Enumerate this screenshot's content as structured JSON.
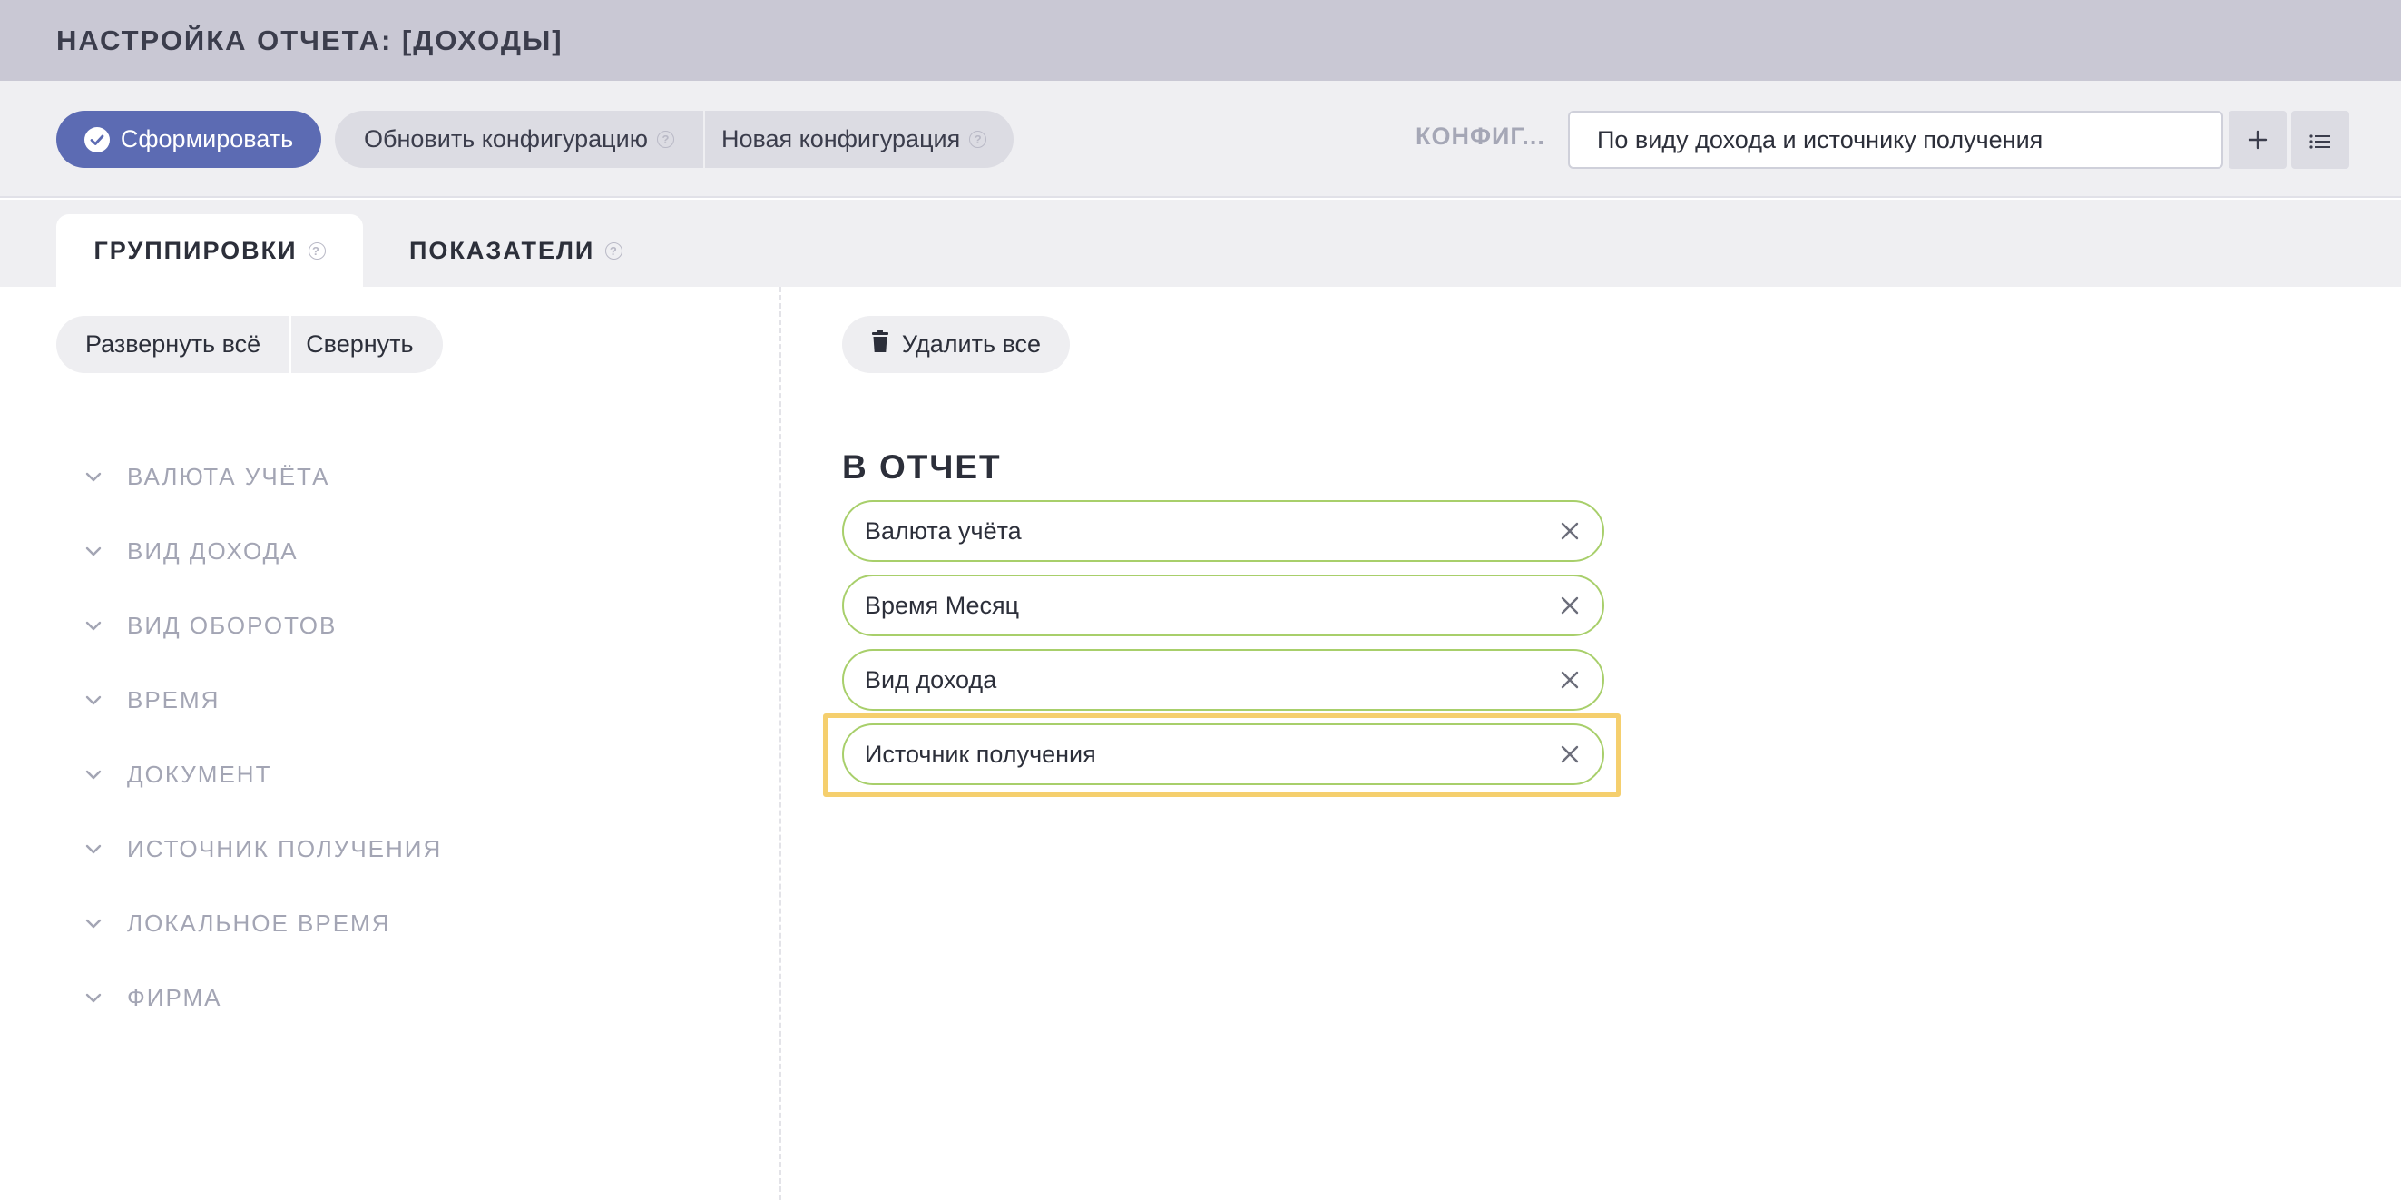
{
  "header": {
    "title": "НАСТРОЙКА ОТЧЕТА: [ДОХОДЫ]"
  },
  "toolbar": {
    "generate_label": "Сформировать",
    "update_config_label": "Обновить конфигурацию",
    "new_config_label": "Новая конфигурация",
    "config_label": "КОНФИГ...",
    "config_value": "По виду дохода и источнику получения",
    "add_icon": "plus-icon",
    "list_icon": "list-icon"
  },
  "tabs": [
    {
      "label": "ГРУППИРОВКИ",
      "active": true
    },
    {
      "label": "ПОКАЗАТЕЛИ",
      "active": false
    }
  ],
  "left": {
    "expand_all": "Развернуть всё",
    "collapse": "Свернуть",
    "groups": [
      "ВАЛЮТА УЧЁТА",
      "ВИД ДОХОДА",
      "ВИД ОБОРОТОВ",
      "ВРЕМЯ",
      "ДОКУМЕНТ",
      "ИСТОЧНИК ПОЛУЧЕНИЯ",
      "ЛОКАЛЬНОЕ ВРЕМЯ",
      "ФИРМА"
    ]
  },
  "right": {
    "delete_all": "Удалить все",
    "section_title": "В ОТЧЕТ",
    "items": [
      "Валюта учёта",
      "Время Месяц",
      "Вид дохода",
      "Источник получения"
    ],
    "highlighted_item": "Источник получения"
  },
  "colors": {
    "header_bg": "#c9c8d4",
    "primary": "#5c6bb3",
    "item_border": "#a8cf6b",
    "highlight": "#f5cf6e"
  }
}
